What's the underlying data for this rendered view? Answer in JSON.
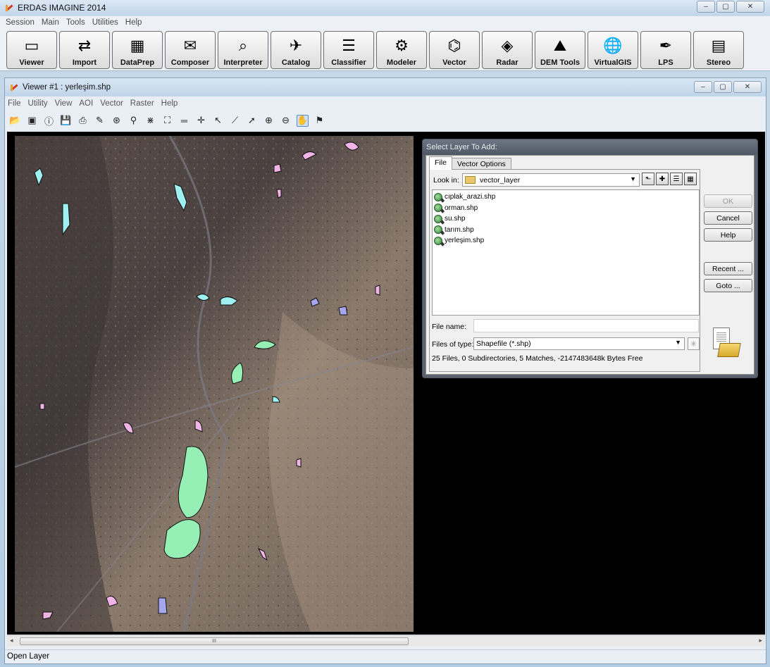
{
  "app": {
    "title": "ERDAS IMAGINE 2014",
    "menu": [
      "Session",
      "Main",
      "Tools",
      "Utilities",
      "Help"
    ],
    "toolbar": [
      {
        "label": "Viewer",
        "icon": "viewer-icon",
        "glyph": "▭"
      },
      {
        "label": "Import",
        "icon": "import-icon",
        "glyph": "⇄"
      },
      {
        "label": "DataPrep",
        "icon": "dataprep-icon",
        "glyph": "▦"
      },
      {
        "label": "Composer",
        "icon": "composer-icon",
        "glyph": "✉"
      },
      {
        "label": "Interpreter",
        "icon": "interpreter-icon",
        "glyph": "⌕"
      },
      {
        "label": "Catalog",
        "icon": "catalog-icon",
        "glyph": "✈"
      },
      {
        "label": "Classifier",
        "icon": "classifier-icon",
        "glyph": "☰"
      },
      {
        "label": "Modeler",
        "icon": "modeler-icon",
        "glyph": "⚙"
      },
      {
        "label": "Vector",
        "icon": "vector-icon",
        "glyph": "⌬"
      },
      {
        "label": "Radar",
        "icon": "radar-icon",
        "glyph": "◈"
      },
      {
        "label": "DEM Tools",
        "icon": "dem-tools-icon",
        "glyph": "⛰"
      },
      {
        "label": "VirtualGIS",
        "icon": "virtualgis-icon",
        "glyph": "🌐"
      },
      {
        "label": "LPS",
        "icon": "lps-icon",
        "glyph": "✒"
      },
      {
        "label": "Stereo",
        "icon": "stereo-icon",
        "glyph": "▤"
      }
    ]
  },
  "viewer": {
    "title": "Viewer #1 : yerleşim.shp",
    "menu": [
      "File",
      "Utility",
      "View",
      "AOI",
      "Vector",
      "Raster",
      "Help"
    ],
    "tools": [
      {
        "name": "open-icon",
        "glyph": "📂"
      },
      {
        "name": "new-window-icon",
        "glyph": "▣"
      },
      {
        "name": "info-icon",
        "glyph": "ⓘ"
      },
      {
        "name": "save-icon",
        "glyph": "💾"
      },
      {
        "name": "print-icon",
        "glyph": "⎙"
      },
      {
        "name": "eraser-icon",
        "glyph": "✎"
      },
      {
        "name": "layer-icon",
        "glyph": "⊛"
      },
      {
        "name": "measure-icon",
        "glyph": "⚲"
      },
      {
        "name": "zoom-to-fit-icon",
        "glyph": "⋇"
      },
      {
        "name": "fullscreen-icon",
        "glyph": "⛶"
      },
      {
        "name": "ruler-icon",
        "glyph": "═"
      },
      {
        "name": "crosshair-icon",
        "glyph": "✛"
      },
      {
        "name": "pointer-icon",
        "glyph": "↖"
      },
      {
        "name": "graph-icon",
        "glyph": "⟋"
      },
      {
        "name": "select-arrow-icon",
        "glyph": "➚"
      },
      {
        "name": "zoom-in-icon",
        "glyph": "⊕"
      },
      {
        "name": "zoom-out-icon",
        "glyph": "⊖"
      },
      {
        "name": "pan-hand-icon",
        "glyph": "✋",
        "active": true
      },
      {
        "name": "inquire-icon",
        "glyph": "⚑"
      }
    ],
    "status": "Open Layer",
    "scroll_thumb": "III"
  },
  "dialog": {
    "title": "Select Layer To Add:",
    "tabs": [
      "File",
      "Vector Options"
    ],
    "look_in_label": "Look in:",
    "look_in_value": "vector_layer",
    "files": [
      "cıplak_arazi.shp",
      "orman.shp",
      "su.shp",
      "tarım.shp",
      "yerleşim.shp"
    ],
    "file_name_label": "File name:",
    "file_name_value": "",
    "file_type_label": "Files of type:",
    "file_type_value": "Shapefile (*.shp)",
    "info": "25 Files, 0 Subdirectories, 5 Matches, -2147483648k Bytes Free",
    "buttons": {
      "ok": "OK",
      "cancel": "Cancel",
      "help": "Help",
      "recent": "Recent ...",
      "goto": "Goto ..."
    }
  },
  "colors": {
    "water": "#9ff0f0",
    "forest": "#96f0b6",
    "bare": "#f0b4e6",
    "agri": "#a6a6ee",
    "settlement": "#f0c4d4"
  }
}
